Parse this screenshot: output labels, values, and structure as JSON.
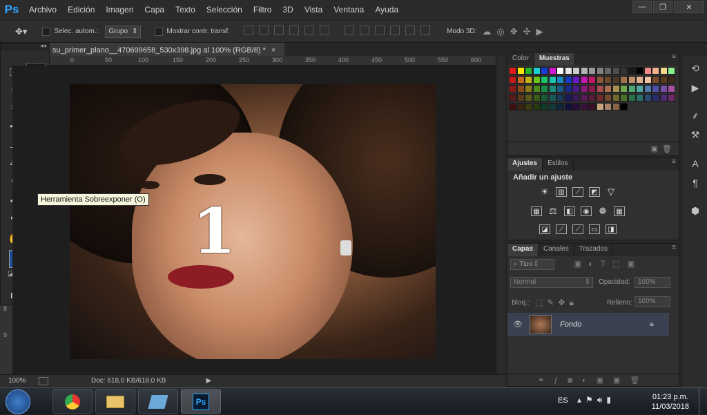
{
  "app": {
    "logo": "Ps"
  },
  "menu": [
    "Archivo",
    "Edición",
    "Imagen",
    "Capa",
    "Texto",
    "Selección",
    "Filtro",
    "3D",
    "Vista",
    "Ventana",
    "Ayuda"
  ],
  "window_controls": {
    "minimize": "—",
    "restore": "❐",
    "close": "✕"
  },
  "options_bar": {
    "auto_select_label": "Selec. autom.:",
    "group_value": "Grupo",
    "show_transform_label": "Mostrar contr. transf.",
    "mode3d_label": "Modo 3D:"
  },
  "tooltip": "Herramienta Sobreexponer (O)",
  "document": {
    "tab_title": "su_primer_plano__470699658_530x398.jpg al 100% (RGB/8) *",
    "tab_close": "×",
    "overlay_text": "1",
    "zoom": "100%",
    "doc_info": "Doc: 618,0 KB/618,0 KB"
  },
  "rulers": {
    "top": [
      "0",
      "50",
      "100",
      "150",
      "200",
      "250",
      "300",
      "350",
      "400",
      "450",
      "500",
      "550",
      "600",
      "650"
    ],
    "left": [
      "8",
      "9"
    ]
  },
  "colors": {
    "foreground": "#1b4f9c",
    "background": "#c9c9c9",
    "accent": "#31a8ff"
  },
  "swatches_panel": {
    "tabs": [
      "Color",
      "Muestras"
    ],
    "active_tab": "Muestras"
  },
  "adjustments_panel": {
    "tabs": [
      "Ajustes",
      "Estilos"
    ],
    "active_tab": "Ajustes",
    "heading": "Añadir un ajuste"
  },
  "layers_panel": {
    "tabs": [
      "Capas",
      "Canales",
      "Trazados"
    ],
    "active_tab": "Capas",
    "filter_label": "Tipo",
    "blend_mode": "Normal",
    "opacity_label": "Opacidad:",
    "opacity_value": "100%",
    "lock_label": "Bloq.:",
    "fill_label": "Relleno:",
    "fill_value": "100%",
    "layers": [
      {
        "name": "Fondo"
      }
    ]
  },
  "taskbar": {
    "language": "ES",
    "time": "01:23 p.m.",
    "date": "11/03/2018",
    "ps_label": "Ps"
  }
}
